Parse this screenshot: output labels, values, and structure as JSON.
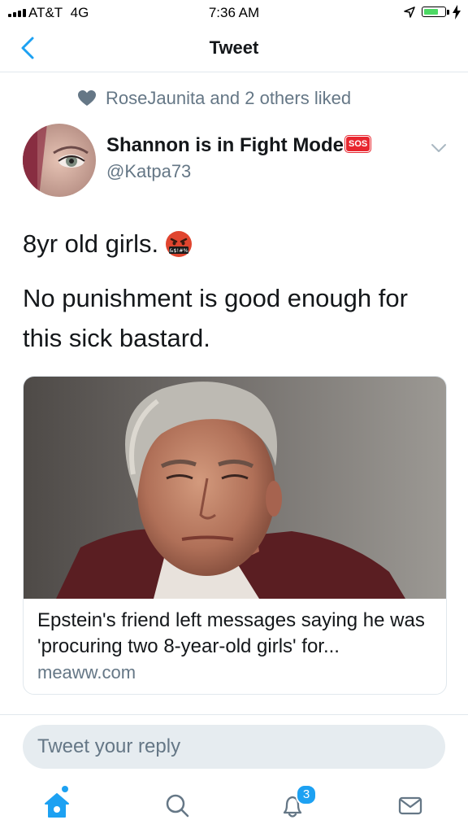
{
  "status_bar": {
    "carrier": "AT&T",
    "network": "4G",
    "time": "7:36 AM",
    "battery_level": 0.75,
    "icons": [
      "signal-icon",
      "location-icon",
      "battery-icon",
      "charging-bolt-icon"
    ]
  },
  "nav": {
    "title": "Tweet",
    "back_icon": "chevron-left-icon"
  },
  "social_context": {
    "text": "RoseJaunita and 2 others liked",
    "icon": "heart-icon"
  },
  "tweet": {
    "author_name": "Shannon is in Fight Mode",
    "author_badge": "SOS",
    "author_handle": "@Katpa73",
    "line1": "8yr old girls.",
    "line1_emoji": "face-with-symbols-icon",
    "line2": "No punishment is good enough for this sick bastard."
  },
  "card": {
    "title": "Epstein's friend left messages saying he was 'procuring two 8-year-old girls' for...",
    "domain": "meaww.com"
  },
  "reply": {
    "placeholder": "Tweet your reply"
  },
  "tab_bar": {
    "notifications_count": "3",
    "tabs": [
      "home-icon",
      "search-icon",
      "notifications-icon",
      "messages-icon"
    ]
  },
  "colors": {
    "accent": "#1da1f2",
    "text_primary": "#14171a",
    "text_secondary": "#657786",
    "divider": "#e1e8ed",
    "reply_bg": "#e6ecf0",
    "sos_red": "#e8262f"
  }
}
